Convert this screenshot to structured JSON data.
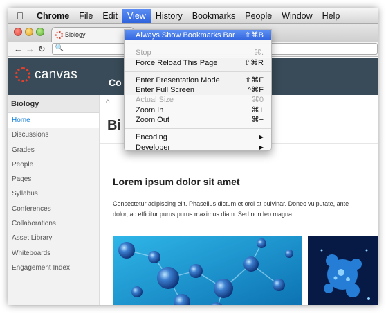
{
  "menubar": {
    "app": "Chrome",
    "items": [
      "File",
      "Edit",
      "View",
      "History",
      "Bookmarks",
      "People",
      "Window",
      "Help"
    ]
  },
  "tab": {
    "title": "Biology"
  },
  "canvas": {
    "logo_text": "canvas",
    "nav_peek": "Co"
  },
  "sidebar": {
    "course": "Biology",
    "items": [
      "Home",
      "Discussions",
      "Grades",
      "People",
      "Pages",
      "Syllabus",
      "Conferences",
      "Collaborations",
      "Asset Library",
      "Whiteboards",
      "Engagement Index"
    ]
  },
  "main": {
    "page_title_peek": "Bi",
    "heading": "Lorem ipsum dolor sit amet",
    "body_line1": "Consectetur adipiscing elit. Phasellus dictum et orci at pulvinar. Donec vulputate, ante",
    "body_line2": "dolor, ac efficitur purus purus maximus diam. Sed non leo magna."
  },
  "view_menu": {
    "always_show_bookmarks": {
      "label": "Always Show Bookmarks Bar",
      "shortcut": "⇧⌘B"
    },
    "stop": {
      "label": "Stop",
      "shortcut": "⌘."
    },
    "force_reload": {
      "label": "Force Reload This Page",
      "shortcut": "⇧⌘R"
    },
    "presentation": {
      "label": "Enter Presentation Mode",
      "shortcut": "⇧⌘F"
    },
    "full_screen": {
      "label": "Enter Full Screen",
      "shortcut": "^⌘F"
    },
    "actual_size": {
      "label": "Actual Size",
      "shortcut": "⌘0"
    },
    "zoom_in": {
      "label": "Zoom In",
      "shortcut": "⌘+"
    },
    "zoom_out": {
      "label": "Zoom Out",
      "shortcut": "⌘−"
    },
    "encoding": {
      "label": "Encoding"
    },
    "developer": {
      "label": "Developer"
    }
  },
  "colors": {
    "canvas_header": "#394b58",
    "canvas_red": "#e4402c",
    "menu_highlight": "#3a6fe3",
    "active_link": "#0a7bd6"
  }
}
